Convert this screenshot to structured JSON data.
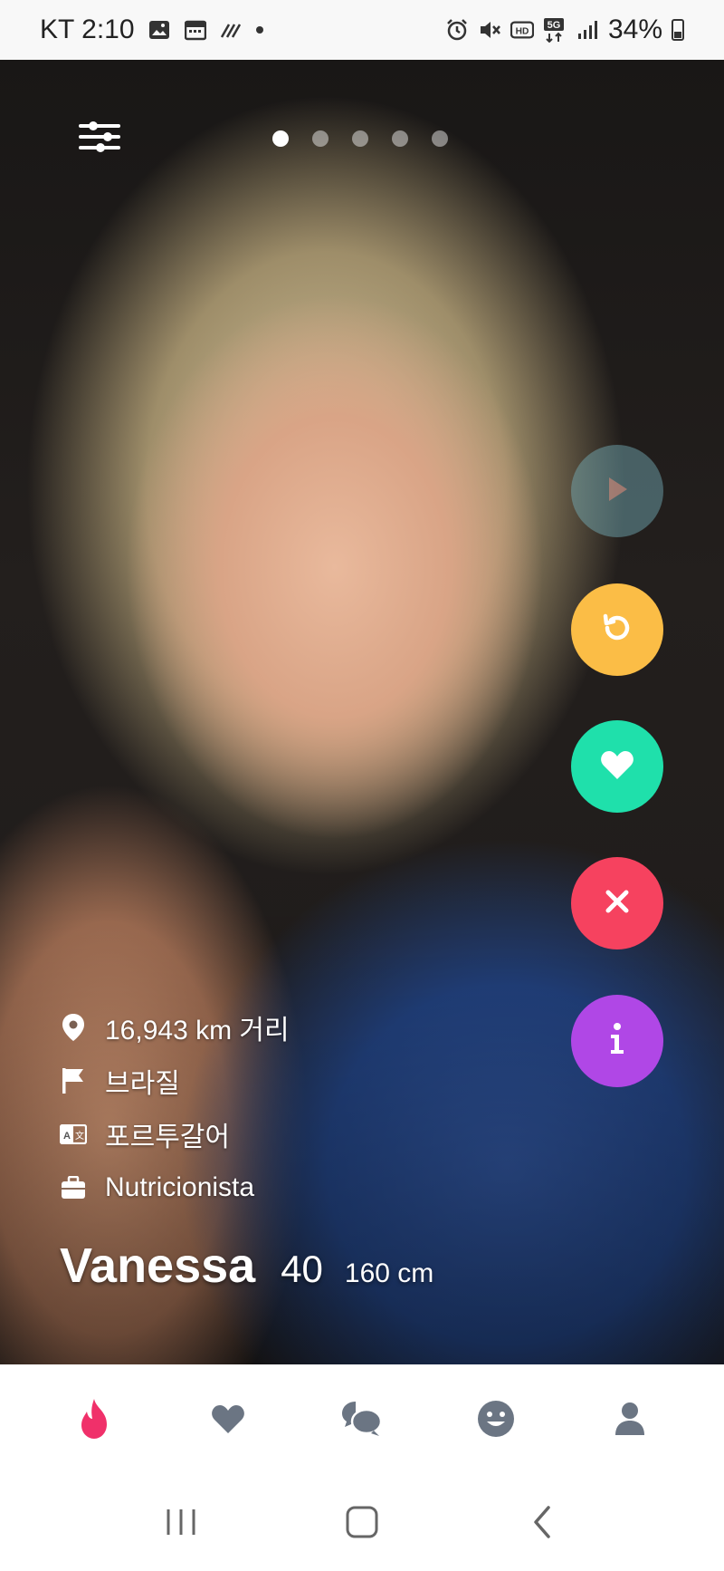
{
  "status_bar": {
    "carrier_time": "KT 2:10",
    "battery": "34%",
    "icons": [
      "image-icon",
      "calendar-icon",
      "signal-slash-icon",
      "dot-icon",
      "alarm-icon",
      "mute-icon",
      "hd-icon",
      "5g-icon",
      "signal-icon",
      "battery-icon"
    ]
  },
  "profile": {
    "name": "Vanessa",
    "age": "40",
    "height": "160 cm",
    "distance": "16,943 km 거리",
    "country": "브라질",
    "language": "포르투갈어",
    "job": "Nutricionista",
    "photo_count": 5,
    "active_photo": 1
  },
  "actions": [
    "play-icon",
    "undo-icon",
    "heart-icon",
    "close-icon",
    "info-icon"
  ],
  "colors": {
    "undo": "#fbbd46",
    "like": "#1fe0ab",
    "nope": "#f6425f",
    "info": "#b047e6",
    "nav_active": "#f0306a",
    "nav_inactive": "#6b7583"
  },
  "bottom_nav": [
    "flame-icon",
    "heart-icon",
    "chat-icon",
    "smile-icon",
    "person-icon"
  ],
  "system_nav": [
    "recents-icon",
    "home-icon",
    "back-icon"
  ]
}
